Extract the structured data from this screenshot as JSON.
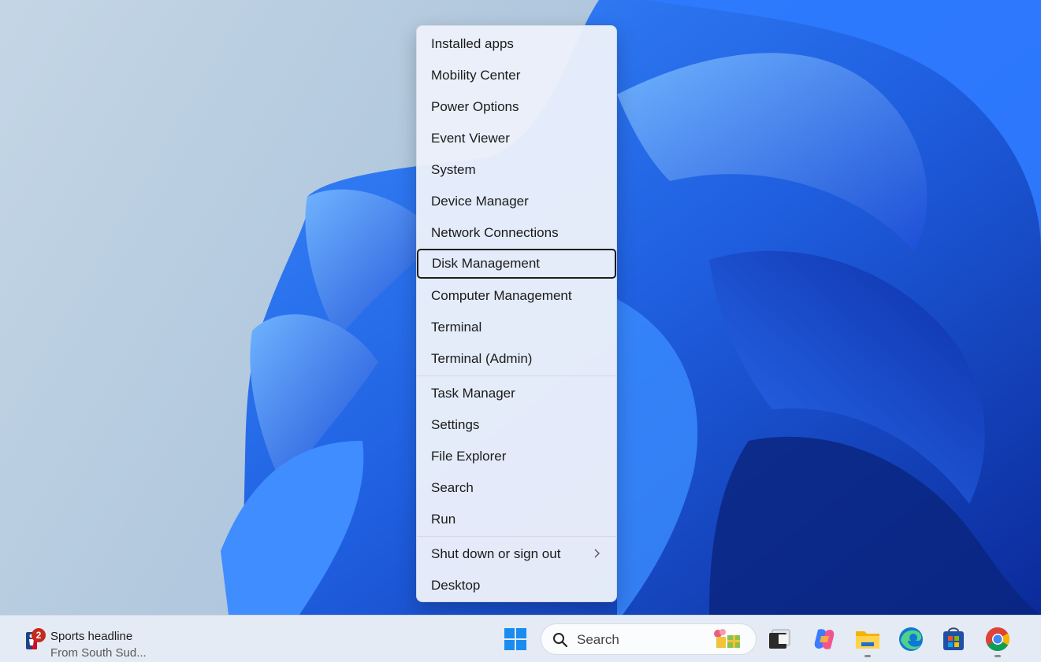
{
  "menu": {
    "groups": [
      [
        "Installed apps",
        "Mobility Center",
        "Power Options",
        "Event Viewer",
        "System",
        "Device Manager",
        "Network Connections",
        "Disk Management",
        "Computer Management",
        "Terminal",
        "Terminal (Admin)"
      ],
      [
        "Task Manager",
        "Settings",
        "File Explorer",
        "Search",
        "Run"
      ],
      [
        "Shut down or sign out",
        "Desktop"
      ]
    ],
    "focused_item": "Disk Management"
  },
  "taskbar": {
    "widget": {
      "badge_count": "2",
      "title": "Sports headline",
      "subtitle": "From South Sud..."
    },
    "search": {
      "placeholder": "Search"
    },
    "icons": [
      "windows-start-icon",
      "search-icon",
      "task-view-icon",
      "copilot-icon",
      "file-explorer-icon",
      "edge-icon",
      "microsoft-store-icon",
      "chrome-icon"
    ]
  },
  "colors": {
    "accent": "#0067c0",
    "badge": "#c42b1c"
  }
}
